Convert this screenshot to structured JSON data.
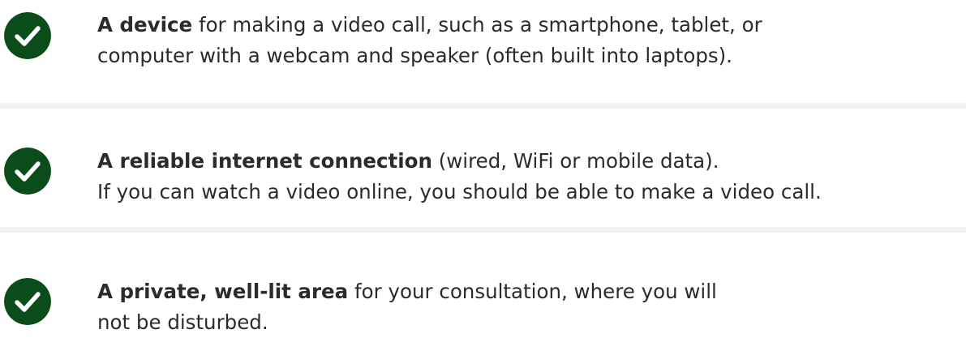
{
  "colors": {
    "check_fill": "#0b4d1a",
    "check_mark": "#ffffff",
    "divider": "#f0f0f0",
    "text": "#2b2b2b"
  },
  "items": [
    {
      "icon": "check-circle-icon",
      "bold": "A device",
      "line1_rest": " for making a video call, such as a smartphone, tablet, or",
      "line2": "computer with a webcam and speaker (often built into laptops)."
    },
    {
      "icon": "check-circle-icon",
      "bold": "A reliable internet connection",
      "line1_rest": " (wired, WiFi or mobile data).",
      "line2": "If you can watch a video online, you should be able to make a video call."
    },
    {
      "icon": "check-circle-icon",
      "bold": "A private, well-lit area",
      "line1_rest": " for your consultation, where you will",
      "line2": "not be disturbed."
    }
  ]
}
